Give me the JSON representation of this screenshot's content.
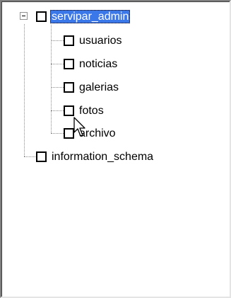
{
  "tree": {
    "root": {
      "label": "servipar_admin",
      "expanded": true,
      "selected": true,
      "checked": false,
      "children": [
        {
          "label": "usuarios",
          "checked": false
        },
        {
          "label": "noticias",
          "checked": false
        },
        {
          "label": "galerias",
          "checked": false
        },
        {
          "label": "fotos",
          "checked": false
        },
        {
          "label": "archivo",
          "checked": false
        }
      ]
    },
    "second_root": {
      "label": "information_schema",
      "checked": false
    }
  },
  "icons": {
    "expander": "minus-box-icon",
    "cursor": "arrow-cursor-icon"
  },
  "colors": {
    "selection": "#3a77e8",
    "connector": "#8a8a8a"
  }
}
